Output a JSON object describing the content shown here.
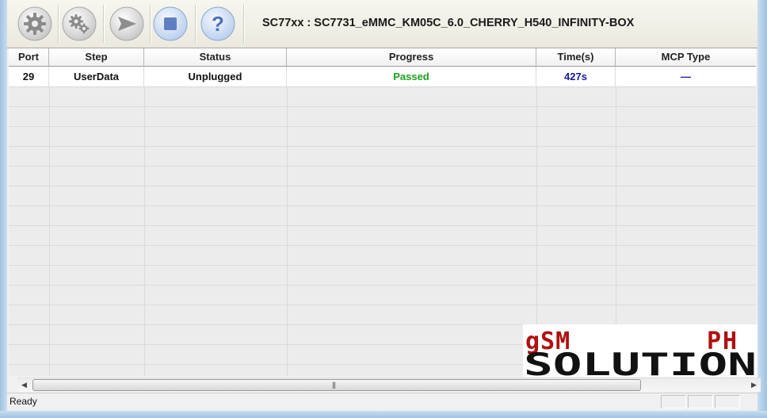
{
  "toolbar": {
    "buttons": [
      {
        "name": "settings-button",
        "icon": "gear-icon"
      },
      {
        "name": "advanced-settings-button",
        "icon": "gears-icon"
      },
      {
        "name": "start-button",
        "icon": "play-arrow-icon"
      },
      {
        "name": "stop-button",
        "icon": "stop-square-icon"
      },
      {
        "name": "help-button",
        "icon": "question-icon"
      }
    ],
    "title": "SC77xx : SC7731_eMMC_KM05C_6.0_CHERRY_H540_INFINITY-BOX"
  },
  "table": {
    "headers": [
      "Port",
      "Step",
      "Status",
      "Progress",
      "Time(s)",
      "MCP Type"
    ],
    "rows": [
      {
        "port": "29",
        "step": "UserData",
        "status": "Unplugged",
        "progress": "Passed",
        "time": "427s",
        "mcp": "—"
      }
    ]
  },
  "watermark": {
    "line1_left": "gSM",
    "line1_right": "PH",
    "line2": "SOLUTION"
  },
  "statusbar": {
    "text": "Ready"
  },
  "colors": {
    "passed": "#1aa31a",
    "time": "#1a1a9a",
    "mcp": "#1a1a9a",
    "watermark_red": "#b01010",
    "watermark_black": "#111111"
  }
}
